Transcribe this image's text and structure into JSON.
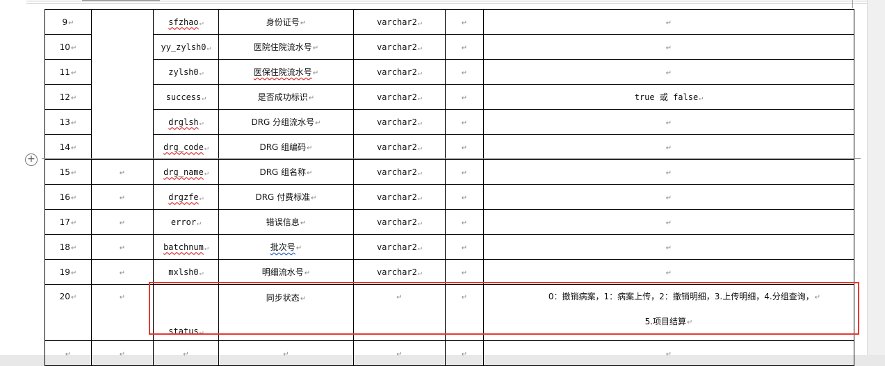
{
  "marker": "↵",
  "rows": [
    {
      "no": "9",
      "field": "sfzhao",
      "name": "身份证号",
      "type": "varchar2",
      "len": "",
      "desc": ""
    },
    {
      "no": "10",
      "field": "yy_zylsh0",
      "name": "医院住院流水号",
      "type": "varchar2",
      "len": "",
      "desc": ""
    },
    {
      "no": "11",
      "field": "zylsh0",
      "name": "医保住院流水号",
      "type": "varchar2",
      "len": "",
      "desc": ""
    },
    {
      "no": "12",
      "field": "success",
      "name": "是否成功标识",
      "type": "varchar2",
      "len": "",
      "desc": "true 或 false"
    },
    {
      "no": "13",
      "field": "drglsh",
      "name": "DRG 分组流水号",
      "type": "varchar2",
      "len": "",
      "desc": ""
    },
    {
      "no": "14",
      "field": "drg_code",
      "name": "DRG 组编码",
      "type": "varchar2",
      "len": "",
      "desc": ""
    },
    {
      "no": "15",
      "field": "drg_name",
      "name": "DRG 组名称",
      "type": "varchar2",
      "len": "",
      "desc": ""
    },
    {
      "no": "16",
      "field": "drgzfe",
      "name": "DRG 付费标准",
      "type": "varchar2",
      "len": "",
      "desc": ""
    },
    {
      "no": "17",
      "field": "error",
      "name": "错误信息",
      "type": "varchar2",
      "len": "",
      "desc": ""
    },
    {
      "no": "18",
      "field": "batchnum",
      "name": "批次号",
      "type": "varchar2",
      "len": "",
      "desc": ""
    },
    {
      "no": "19",
      "field": "mxlsh0",
      "name": "明细流水号",
      "type": "varchar2",
      "len": "",
      "desc": ""
    }
  ],
  "row20": {
    "no": "20",
    "field": "status",
    "name": "同步状态",
    "desc_line1": "0：撤销病案，1：病案上传，2：撤销明细，3.上传明细，4.分组查询，",
    "desc_line2": "5.项目结算"
  }
}
